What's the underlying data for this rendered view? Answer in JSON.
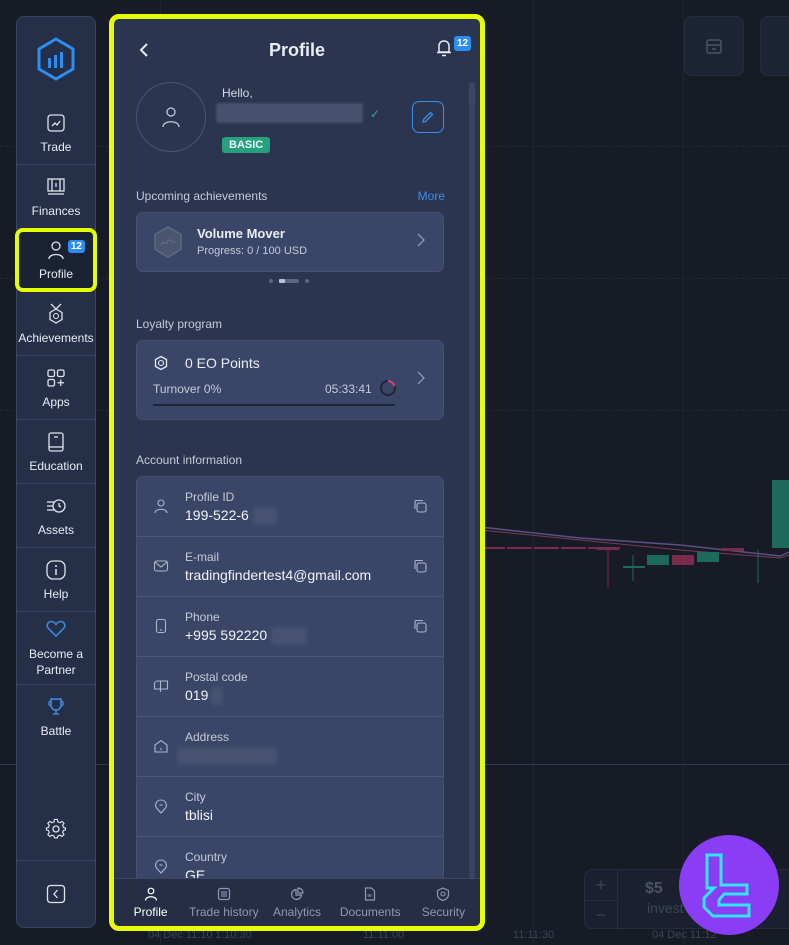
{
  "sidebar": {
    "items": [
      {
        "label": "Trade",
        "icon": "trade-chart-icon"
      },
      {
        "label": "Finances",
        "icon": "finances-icon"
      },
      {
        "label": "Profile",
        "icon": "user-icon",
        "badge": "12",
        "active": true
      },
      {
        "label": "Achievements",
        "icon": "medal-icon"
      },
      {
        "label": "Apps",
        "icon": "apps-icon"
      },
      {
        "label": "Education",
        "icon": "book-icon"
      },
      {
        "label": "Assets",
        "icon": "assets-clock-icon"
      },
      {
        "label": "Help",
        "icon": "info-icon"
      },
      {
        "label": "Become a Partner",
        "icon": "heart-icon"
      },
      {
        "label": "Battle",
        "icon": "trophy-icon"
      }
    ],
    "settings_icon": "gear-icon",
    "collapse_icon": "chevron-left-icon"
  },
  "profile_panel": {
    "title": "Profile",
    "notification_count": "12",
    "greeting": "Hello,",
    "account_level": "BASIC",
    "upcoming_achievements": {
      "label": "Upcoming achievements",
      "more_label": "More",
      "card": {
        "title": "Volume Mover",
        "progress": "Progress: 0 / 100 USD"
      },
      "pager_active_index": 1,
      "pager_count": 3
    },
    "loyalty": {
      "label": "Loyalty program",
      "points": "0 EO Points",
      "turnover": "Turnover 0%",
      "turnover_percent": 0,
      "timer": "05:33:41"
    },
    "account_information": {
      "label": "Account information",
      "rows": [
        {
          "label": "Profile ID",
          "value": "199-522-6",
          "icon": "user-icon",
          "copy": true
        },
        {
          "label": "E-mail",
          "value": "tradingfindertest4@gmail.com",
          "icon": "envelope-icon",
          "copy": true
        },
        {
          "label": "Phone",
          "value": "+995 592220",
          "icon": "phone-icon",
          "copy": true
        },
        {
          "label": "Postal code",
          "value": "019",
          "icon": "mailbox-icon",
          "copy": false
        },
        {
          "label": "Address",
          "value": "",
          "icon": "home-icon",
          "copy": false
        },
        {
          "label": "City",
          "value": "tblisi",
          "icon": "location-pin-icon",
          "copy": false
        },
        {
          "label": "Country",
          "value": "GE",
          "icon": "location-pin-icon",
          "copy": false
        }
      ]
    },
    "bottom_tabs": [
      {
        "label": "Profile",
        "icon": "user-icon",
        "active": true
      },
      {
        "label": "Trade history",
        "icon": "history-icon"
      },
      {
        "label": "Analytics",
        "icon": "pie-chart-icon"
      },
      {
        "label": "Documents",
        "icon": "document-icon"
      },
      {
        "label": "Security",
        "icon": "shield-icon"
      }
    ]
  },
  "background": {
    "time_labels": [
      "04 Dec 11:10",
      "1:10:30",
      "11:11:00",
      "11:11:30",
      "04 Dec 11:12"
    ],
    "invest_amount": "$5",
    "invest_label": "invest"
  }
}
